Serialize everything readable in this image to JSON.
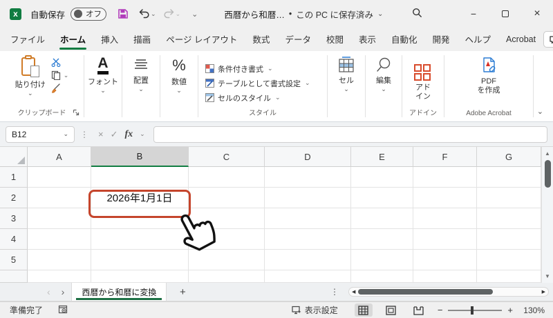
{
  "title_bar": {
    "app_icon_letter": "x",
    "autosave_label": "自動保存",
    "autosave_state": "オフ",
    "doc_title": "西暦から和暦…",
    "doc_status": "この PC に保存済み"
  },
  "tabs": {
    "items": [
      "ファイル",
      "ホーム",
      "挿入",
      "描画",
      "ページ レイアウト",
      "数式",
      "データ",
      "校閲",
      "表示",
      "自動化",
      "開発",
      "ヘルプ",
      "Acrobat"
    ],
    "active": "ホーム"
  },
  "ribbon": {
    "paste_label": "貼り付け",
    "clipboard_group": "クリップボード",
    "font_label": "フォント",
    "font_glyph": "A",
    "align_label": "配置",
    "number_label": "数値",
    "number_glyph": "%",
    "styles_items": [
      "条件付き書式",
      "テーブルとして書式設定",
      "セルのスタイル"
    ],
    "styles_group": "スタイル",
    "cells_label": "セル",
    "edit_label": "編集",
    "addins_line1": "アド",
    "addins_line2": "イン",
    "addins_group": "アドイン",
    "pdf_line1": "PDF",
    "pdf_line2": "を作成",
    "acrobat_group": "Adobe Acrobat"
  },
  "formula_bar": {
    "name_box": "B12",
    "fx_label": "fx",
    "formula_value": ""
  },
  "grid": {
    "columns": [
      "A",
      "B",
      "C",
      "D",
      "E",
      "F",
      "G"
    ],
    "selected_column": "B",
    "rows": [
      "1",
      "2",
      "3",
      "4",
      "5"
    ],
    "b2_value": "2026年1月1日"
  },
  "sheet_bar": {
    "tab_name": "西暦から和暦に変換",
    "add_label": "+"
  },
  "status_bar": {
    "ready": "準備完了",
    "view_settings": "表示設定",
    "zoom_level": "130%"
  },
  "colors": {
    "excel_green": "#107c41",
    "save_purple": "#b13dbb",
    "annotation_red": "#c5452c",
    "addin_red": "#d84a2b"
  },
  "glyphs": {
    "chevron_down": "⌄",
    "check": "✓",
    "cancel_x": "×",
    "close": "×",
    "minimize": "−",
    "dots_v": "⋮",
    "prev": "‹",
    "next": "›",
    "up": "▲",
    "down": "▼",
    "left": "◀",
    "right": "▶",
    "bullet": "•",
    "minus": "−",
    "plus": "+"
  }
}
